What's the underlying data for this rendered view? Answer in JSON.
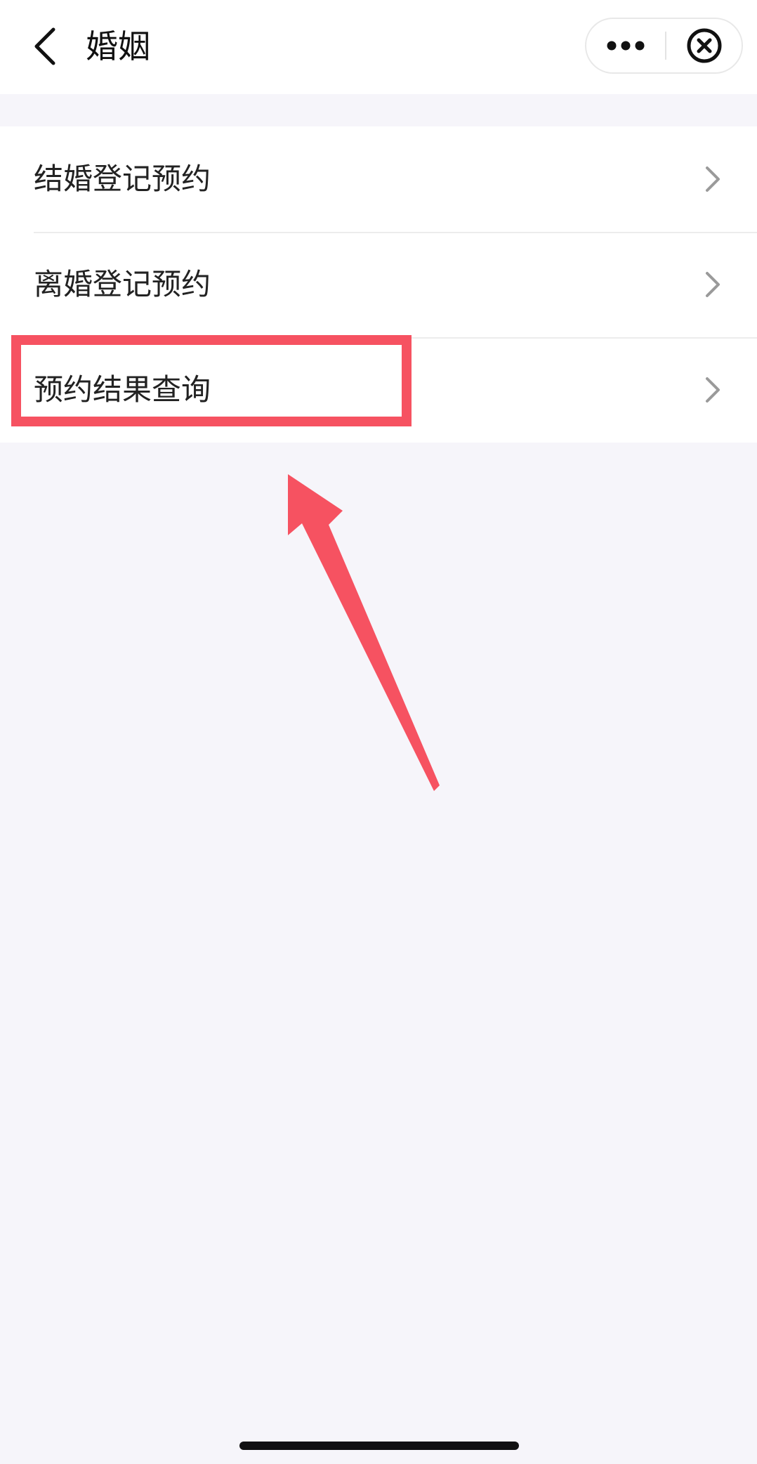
{
  "header": {
    "title": "婚姻"
  },
  "menu": {
    "items": [
      {
        "label": "结婚登记预约"
      },
      {
        "label": "离婚登记预约"
      },
      {
        "label": "预约结果查询"
      }
    ]
  },
  "colors": {
    "annotation": "#f65261",
    "background": "#f6f5fa",
    "card": "#ffffff"
  },
  "icons": {
    "back": "chevron-left-icon",
    "more": "more-dots-icon",
    "close": "close-circle-icon",
    "item_arrow": "chevron-right-icon"
  }
}
